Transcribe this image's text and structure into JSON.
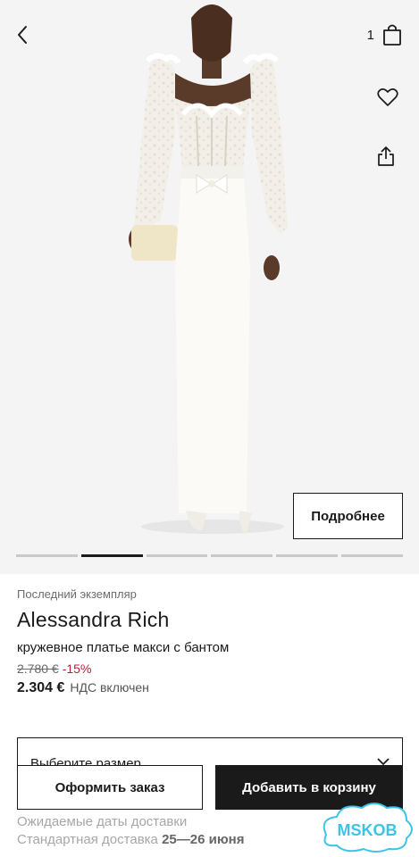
{
  "header": {
    "bag_count": "1"
  },
  "hero": {
    "details_button": "Подробнее",
    "gallery_dots": 6,
    "active_dot": 1
  },
  "product": {
    "availability": "Последний экземпляр",
    "brand": "Alessandra Rich",
    "description": "кружевное платье макси с бантом",
    "old_price": "2.780 €",
    "discount": "-15%",
    "price": "2.304 €",
    "vat_note": "НДС включен"
  },
  "size_select": {
    "placeholder": "Выберите размер"
  },
  "actions": {
    "order_label": "Оформить заказ",
    "add_to_cart_label": "Добавить в корзину"
  },
  "delivery": {
    "title": "Ожидаемые даты доставки",
    "standard_label": "Стандартная доставка",
    "standard_dates": "25—26 июня"
  },
  "watermark": {
    "text": "MSKOB"
  },
  "colors": {
    "accent": "#1a1a1a",
    "discount": "#b51f3a",
    "watermark": "#3ec3e8"
  }
}
